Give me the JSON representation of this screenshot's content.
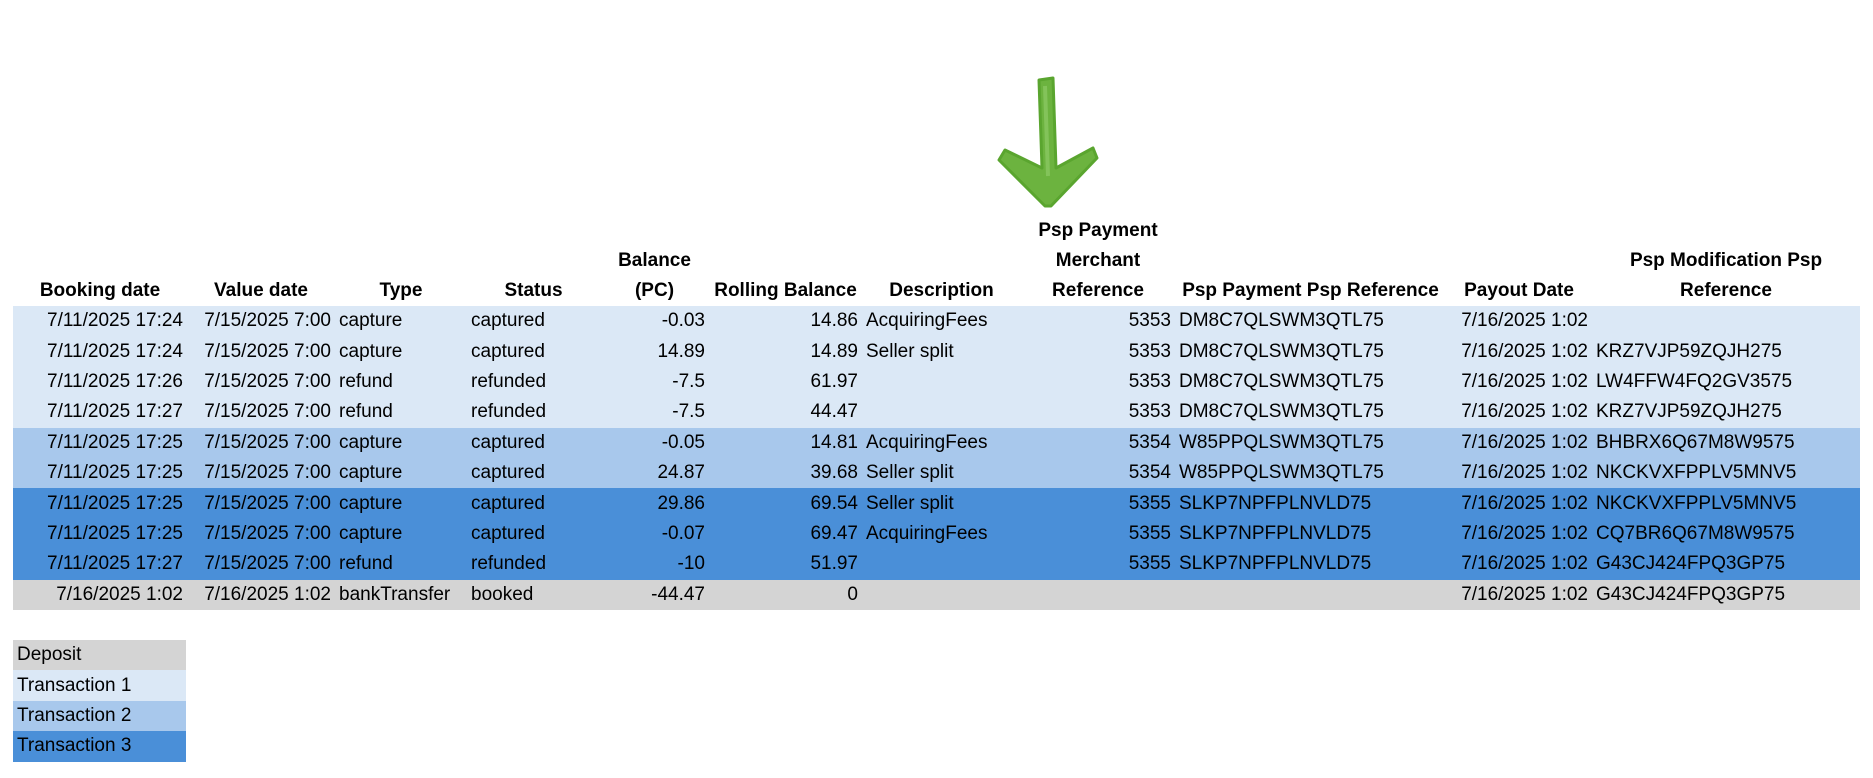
{
  "arrow": {
    "icon": "down-arrow-icon",
    "color": "#6cb33f"
  },
  "table": {
    "headers": {
      "booking_date": "Booking date",
      "value_date": "Value date",
      "type": "Type",
      "status": "Status",
      "balance_pc": "Balance (PC)",
      "rolling_balance": "Rolling Balance",
      "description": "Description",
      "psp_payment_merchant_reference": "Psp Payment Merchant Reference",
      "psp_payment_psp_reference": "Psp Payment Psp Reference",
      "payout_date": "Payout Date",
      "psp_modification_psp_reference": "Psp Modification Psp Reference"
    },
    "rows": [
      {
        "group": "g1",
        "booking_date": "7/11/2025 17:24",
        "value_date": "7/15/2025 7:00",
        "type": "capture",
        "status": "captured",
        "balance_pc": "-0.03",
        "rolling_balance": "14.86",
        "description": "AcquiringFees",
        "merchant_ref": "5353",
        "psp_ref": "DM8C7QLSWM3QTL75",
        "payout_date": "7/16/2025 1:02",
        "mod_ref": ""
      },
      {
        "group": "g1",
        "booking_date": "7/11/2025 17:24",
        "value_date": "7/15/2025 7:00",
        "type": "capture",
        "status": "captured",
        "balance_pc": "14.89",
        "rolling_balance": "14.89",
        "description": "Seller split",
        "merchant_ref": "5353",
        "psp_ref": "DM8C7QLSWM3QTL75",
        "payout_date": "7/16/2025 1:02",
        "mod_ref": "KRZ7VJP59ZQJH275"
      },
      {
        "group": "g1",
        "booking_date": "7/11/2025 17:26",
        "value_date": "7/15/2025 7:00",
        "type": "refund",
        "status": "refunded",
        "balance_pc": "-7.5",
        "rolling_balance": "61.97",
        "description": "",
        "merchant_ref": "5353",
        "psp_ref": "DM8C7QLSWM3QTL75",
        "payout_date": "7/16/2025 1:02",
        "mod_ref": "LW4FFW4FQ2GV3575"
      },
      {
        "group": "g1",
        "booking_date": "7/11/2025 17:27",
        "value_date": "7/15/2025 7:00",
        "type": "refund",
        "status": "refunded",
        "balance_pc": "-7.5",
        "rolling_balance": "44.47",
        "description": "",
        "merchant_ref": "5353",
        "psp_ref": "DM8C7QLSWM3QTL75",
        "payout_date": "7/16/2025 1:02",
        "mod_ref": "KRZ7VJP59ZQJH275"
      },
      {
        "group": "g2",
        "booking_date": "7/11/2025 17:25",
        "value_date": "7/15/2025 7:00",
        "type": "capture",
        "status": "captured",
        "balance_pc": "-0.05",
        "rolling_balance": "14.81",
        "description": "AcquiringFees",
        "merchant_ref": "5354",
        "psp_ref": "W85PPQLSWM3QTL75",
        "payout_date": "7/16/2025 1:02",
        "mod_ref": "BHBRX6Q67M8W9575"
      },
      {
        "group": "g2",
        "booking_date": "7/11/2025 17:25",
        "value_date": "7/15/2025 7:00",
        "type": "capture",
        "status": "captured",
        "balance_pc": "24.87",
        "rolling_balance": "39.68",
        "description": "Seller split",
        "merchant_ref": "5354",
        "psp_ref": "W85PPQLSWM3QTL75",
        "payout_date": "7/16/2025 1:02",
        "mod_ref": "NKCKVXFPPLV5MNV5"
      },
      {
        "group": "g3",
        "booking_date": "7/11/2025 17:25",
        "value_date": "7/15/2025 7:00",
        "type": "capture",
        "status": "captured",
        "balance_pc": "29.86",
        "rolling_balance": "69.54",
        "description": "Seller split",
        "merchant_ref": "5355",
        "psp_ref": "SLKP7NPFPLNVLD75",
        "payout_date": "7/16/2025 1:02",
        "mod_ref": "NKCKVXFPPLV5MNV5"
      },
      {
        "group": "g3",
        "booking_date": "7/11/2025 17:25",
        "value_date": "7/15/2025 7:00",
        "type": "capture",
        "status": "captured",
        "balance_pc": "-0.07",
        "rolling_balance": "69.47",
        "description": "AcquiringFees",
        "merchant_ref": "5355",
        "psp_ref": "SLKP7NPFPLNVLD75",
        "payout_date": "7/16/2025 1:02",
        "mod_ref": "CQ7BR6Q67M8W9575"
      },
      {
        "group": "g3",
        "booking_date": "7/11/2025 17:27",
        "value_date": "7/15/2025 7:00",
        "type": "refund",
        "status": "refunded",
        "balance_pc": "-10",
        "rolling_balance": "51.97",
        "description": "",
        "merchant_ref": "5355",
        "psp_ref": "SLKP7NPFPLNVLD75",
        "payout_date": "7/16/2025 1:02",
        "mod_ref": "G43CJ424FPQ3GP75"
      },
      {
        "group": "dep",
        "booking_date": "7/16/2025 1:02",
        "value_date": "7/16/2025 1:02",
        "type": "bankTransfer",
        "status": "booked",
        "balance_pc": "-44.47",
        "rolling_balance": "0",
        "description": "",
        "merchant_ref": "",
        "psp_ref": "",
        "payout_date": "7/16/2025 1:02",
        "mod_ref": "G43CJ424FPQ3GP75"
      }
    ]
  },
  "legend": {
    "items": [
      {
        "label": "Deposit",
        "color": "#d4d4d4"
      },
      {
        "label": "Transaction 1",
        "color": "#dbe8f6"
      },
      {
        "label": "Transaction 2",
        "color": "#a8c8ec"
      },
      {
        "label": "Transaction 3",
        "color": "#4a8fd8"
      }
    ]
  }
}
